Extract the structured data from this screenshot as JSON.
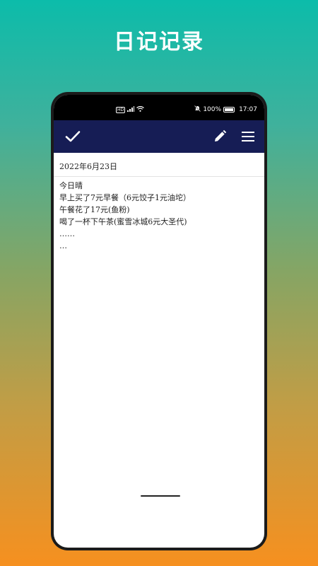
{
  "promo": {
    "title": "日记记录"
  },
  "status_bar": {
    "battery_percent": "100%",
    "time": "17:07",
    "hd_label": "HD"
  },
  "app_bar": {
    "confirm_icon": "check-icon",
    "edit_icon": "pencil-icon",
    "menu_icon": "hamburger-menu-icon",
    "background": "#161d55"
  },
  "note": {
    "date": "2022年6月23日",
    "lines": [
      "今日晴",
      "早上买了7元早餐（6元饺子1元油坨）",
      "午餐花了17元(鱼粉)",
      "喝了一杯下午茶(蜜雪冰城6元大圣代)",
      "……",
      "…"
    ]
  }
}
